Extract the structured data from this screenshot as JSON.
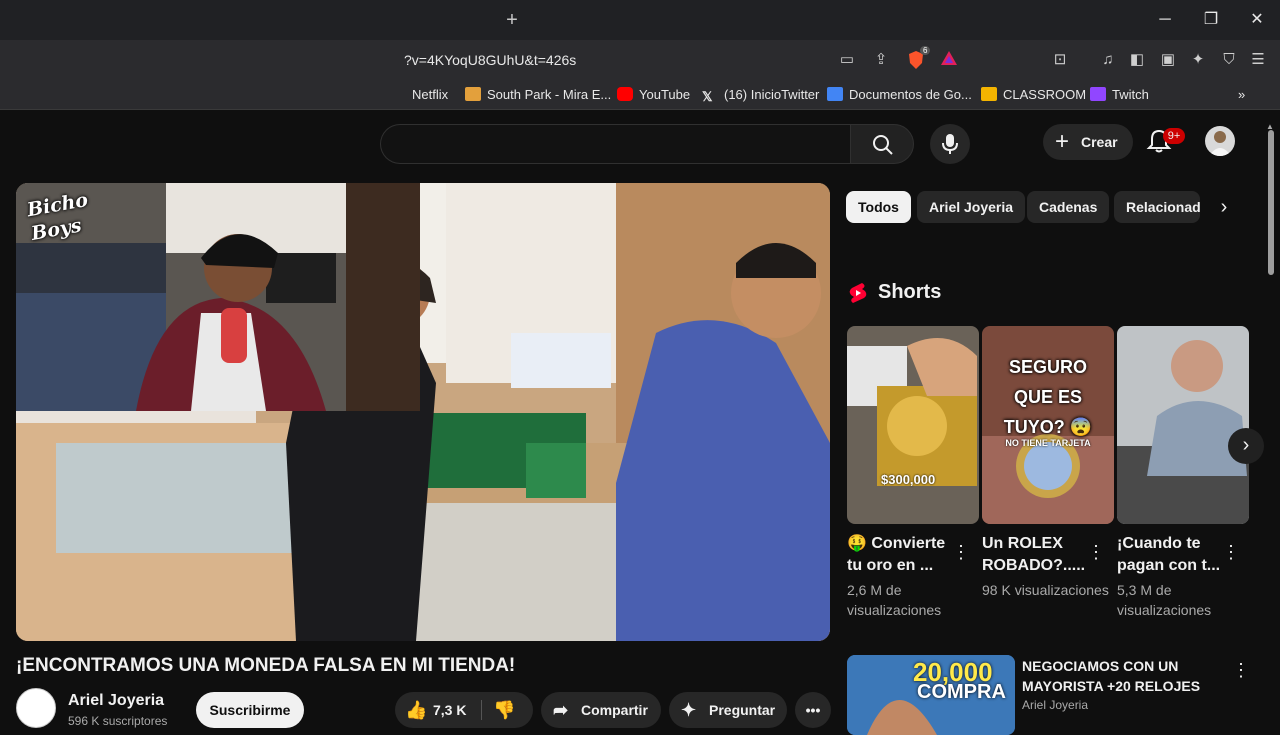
{
  "browser": {
    "url": "?v=4KYoqU8GUhU&t=426s",
    "bookmarks": [
      {
        "label": "Netflix",
        "color": "#2b2b2e"
      },
      {
        "label": "South Park - Mira E...",
        "color": "#e3a03c"
      },
      {
        "label": "YouTube",
        "color": "#ff0000"
      },
      {
        "label": "(16) InicioTwitter",
        "color": "#000000"
      },
      {
        "label": "Documentos de Go...",
        "color": "#4285f4"
      },
      {
        "label": "CLASSROOM",
        "color": "#f4b400"
      },
      {
        "label": "Twitch",
        "color": "#9146ff"
      }
    ],
    "shield_count": "6"
  },
  "header": {
    "create_label": "Crear",
    "notifications": "9+"
  },
  "video": {
    "title": "¡ENCONTRAMOS UNA MONEDA FALSA EN MI TIENDA!",
    "channel": "Ariel Joyeria",
    "subscribers": "596 K suscriptores",
    "subscribe_label": "Suscribirme",
    "likes": "7,3 K",
    "share_label": "Compartir",
    "ask_label": "Preguntar",
    "webcam_logo": "Bicho Boys"
  },
  "chips": [
    "Todos",
    "Ariel Joyeria",
    "Cadenas",
    "Relacionad"
  ],
  "shorts": {
    "section_title": "Shorts",
    "items": [
      {
        "title": "🤑 Convierte tu oro en ...",
        "views": "2,6 M de visualizaciones",
        "overlay": "$300,000"
      },
      {
        "title": "Un ROLEX ROBADO?.....",
        "views": "98 K visualizaciones",
        "overlay": "SEGURO QUE ES TUYO? 😨",
        "overlay2": "NO TIENE TARJETA"
      },
      {
        "title": "¡Cuando te pagan con t...",
        "views": "5,3 M de visualizaciones",
        "overlay": ""
      }
    ]
  },
  "recommendation": {
    "title": "NEGOCIAMOS CON UN MAYORISTA +20 RELOJES",
    "channel": "Ariel Joyeria",
    "thumb_text1": "20,000",
    "thumb_text2": "COMPRA"
  }
}
